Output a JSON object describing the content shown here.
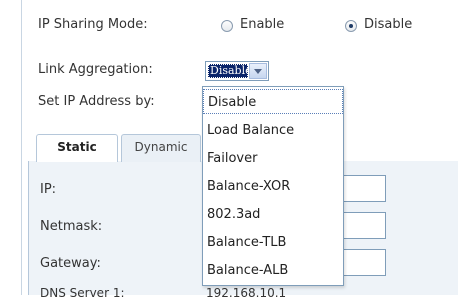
{
  "ip_sharing": {
    "label": "IP Sharing Mode:",
    "options": [
      "Enable",
      "Disable"
    ],
    "selected": "Disable"
  },
  "link_aggregation": {
    "label": "Link Aggregation:",
    "value": "Disable",
    "options": [
      "Disable",
      "Load Balance",
      "Failover",
      "Balance-XOR",
      "802.3ad",
      "Balance-TLB",
      "Balance-ALB"
    ]
  },
  "set_ip": {
    "label": "Set IP Address by:"
  },
  "tabs": [
    {
      "label": "Static",
      "active": true
    },
    {
      "label": "Dynamic",
      "active": false
    }
  ],
  "form": {
    "ip_label": "IP:",
    "netmask_label": "Netmask:",
    "gateway_label": "Gateway:",
    "dns_label": "DNS Server 1:",
    "dns_value": "192.168.10.1"
  },
  "colors": {
    "selection": "#0a246a",
    "border": "#7f9db9",
    "panel": "#eef3f8"
  }
}
